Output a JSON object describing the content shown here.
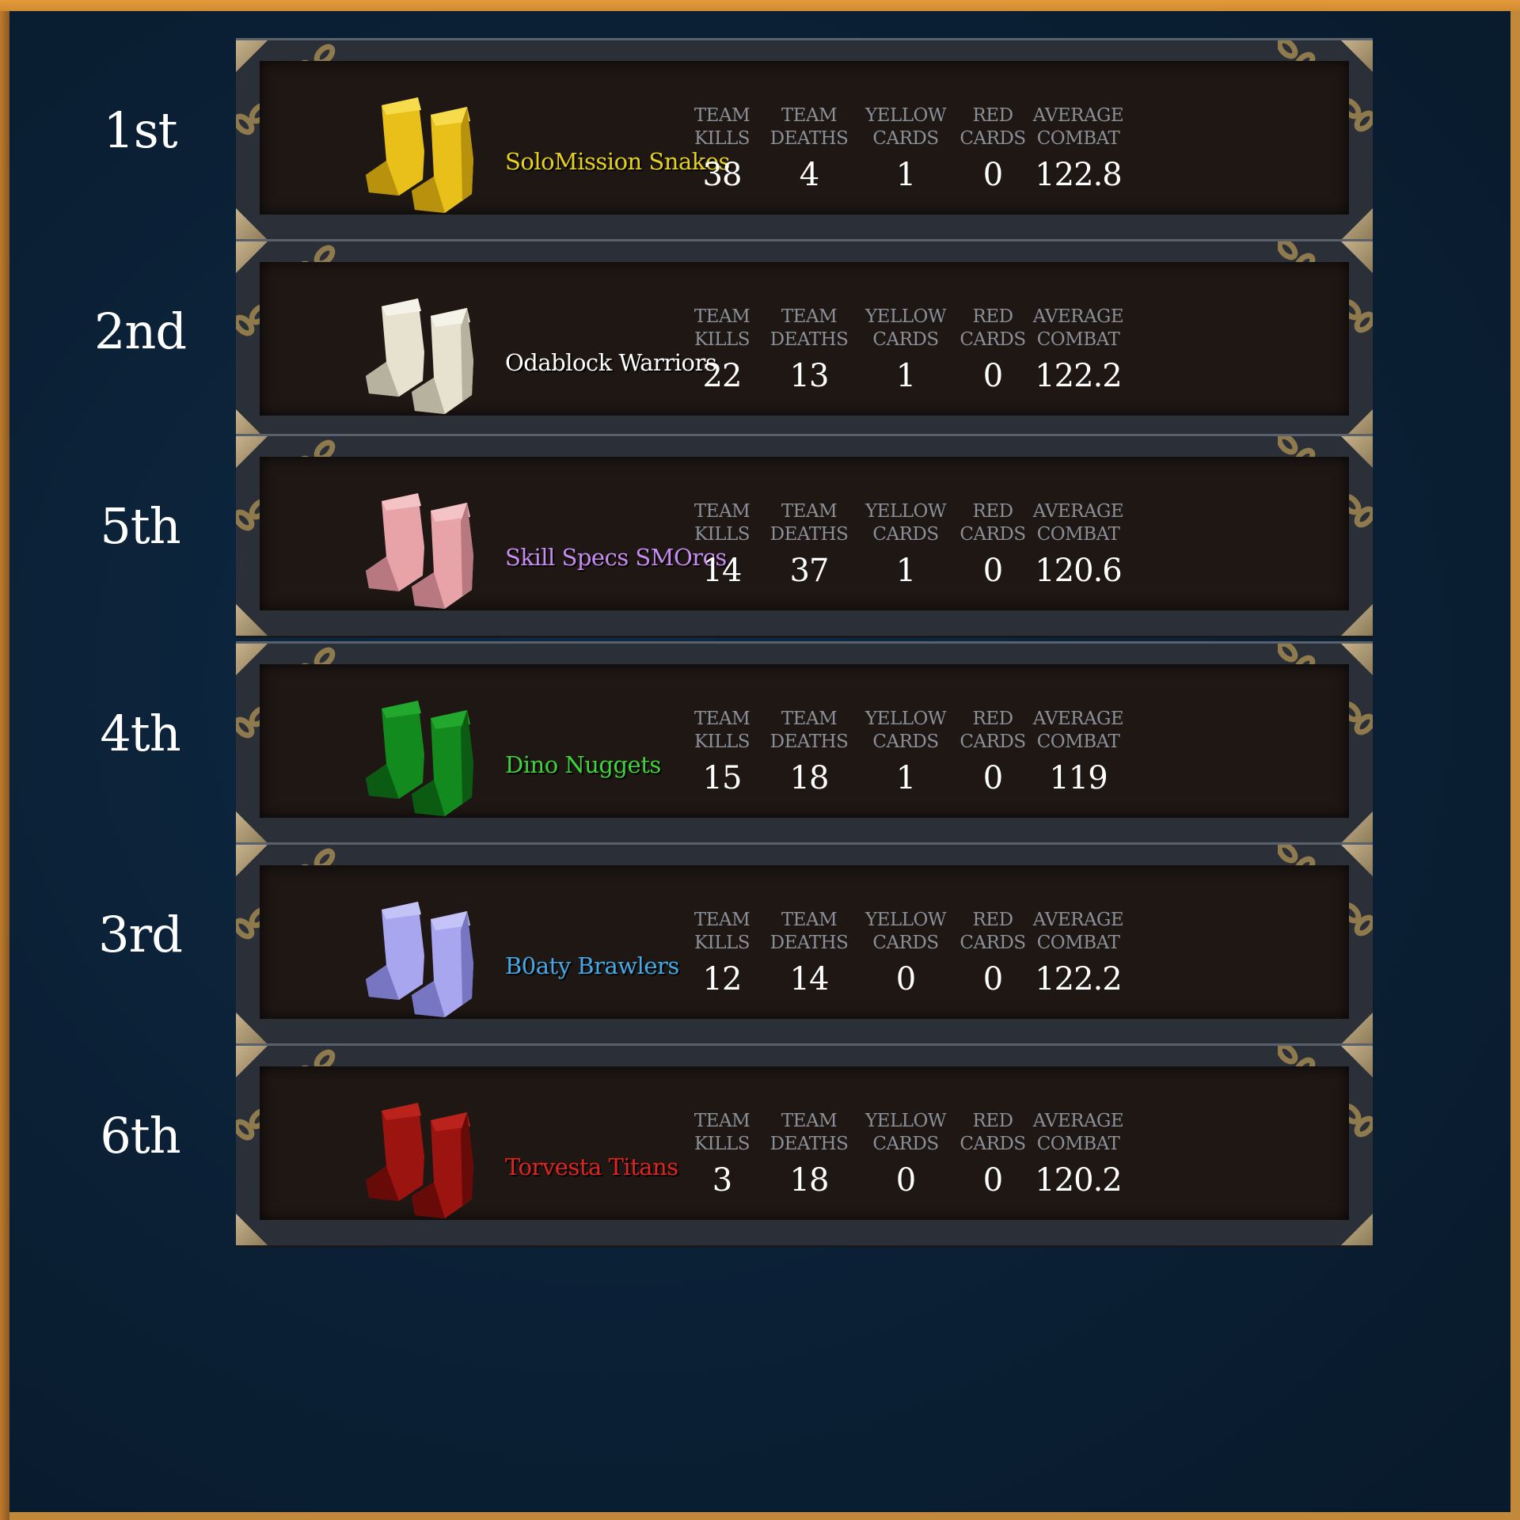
{
  "stat_labels": {
    "team_kills": "TEAM\nKILLS",
    "team_deaths": "TEAM\nDEATHS",
    "yellow_cards": "YELLOW\nCARDS",
    "red_cards": "RED\nCARDS",
    "average_combat": "AVERAGE\nCOMBAT"
  },
  "teams": [
    {
      "rank": "1st",
      "name": "SoloMission Snakes",
      "name_color": "#e6d21e",
      "boot_color": "#e8c019",
      "boot_shade": "#b8920c",
      "boot_light": "#f6db4a",
      "boot_icon": "yellow-boots-icon",
      "team_kills": "38",
      "team_deaths": "4",
      "yellow_cards": "1",
      "red_cards": "0",
      "average_combat": "122.8"
    },
    {
      "rank": "2nd",
      "name": "Odablock Warriors",
      "name_color": "#ffffff",
      "boot_color": "#e6e2cf",
      "boot_shade": "#b6b29d",
      "boot_light": "#f5f3e8",
      "boot_icon": "white-boots-icon",
      "team_kills": "22",
      "team_deaths": "13",
      "yellow_cards": "1",
      "red_cards": "0",
      "average_combat": "122.2"
    },
    {
      "rank": "5th",
      "name": "Skill Specs SMOrcs",
      "name_color": "#c88bf0",
      "boot_color": "#e7a3a8",
      "boot_shade": "#b77880",
      "boot_light": "#f3c3c6",
      "boot_icon": "pink-boots-icon",
      "team_kills": "14",
      "team_deaths": "37",
      "yellow_cards": "1",
      "red_cards": "0",
      "average_combat": "120.6"
    },
    {
      "rank": "4th",
      "name": "Dino Nuggets",
      "name_color": "#3fd23a",
      "boot_color": "#138a1e",
      "boot_shade": "#0b5c12",
      "boot_light": "#21a82d",
      "boot_icon": "green-boots-icon",
      "team_kills": "15",
      "team_deaths": "18",
      "yellow_cards": "1",
      "red_cards": "0",
      "average_combat": "119"
    },
    {
      "rank": "3rd",
      "name": "B0aty Brawlers",
      "name_color": "#44a9e6",
      "boot_color": "#a7a6ee",
      "boot_shade": "#7776c2",
      "boot_light": "#c4c3f7",
      "boot_icon": "lavender-boots-icon",
      "team_kills": "12",
      "team_deaths": "14",
      "yellow_cards": "0",
      "red_cards": "0",
      "average_combat": "122.2"
    },
    {
      "rank": "6th",
      "name": "Torvesta Titans",
      "name_color": "#e0241f",
      "boot_color": "#9c1410",
      "boot_shade": "#680b08",
      "boot_light": "#b9231c",
      "boot_icon": "red-boots-icon",
      "team_kills": "3",
      "team_deaths": "18",
      "yellow_cards": "0",
      "red_cards": "0",
      "average_combat": "120.2"
    }
  ]
}
